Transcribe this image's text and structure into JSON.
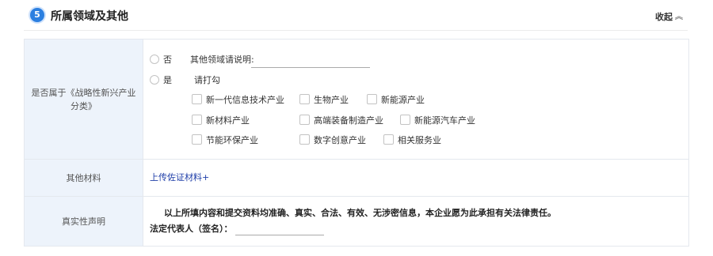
{
  "header": {
    "step_number": "5",
    "title": "所属领域及其他",
    "collapse_label": "收起",
    "collapse_icon": "chevron-up-icon"
  },
  "rows": {
    "strategic": {
      "label": "是否属于《战略性新兴产业分类》",
      "option_no": "否",
      "other_field_label": "其他领域请说明:",
      "other_field_value": "",
      "option_yes": "是",
      "check_prompt": "请打勾",
      "industries": [
        "新一代信息技术产业",
        "生物产业",
        "新能源产业",
        "新材料产业",
        "高端装备制造产业",
        "新能源汽车产业",
        "节能环保产业",
        "数字创意产业",
        "相关服务业"
      ]
    },
    "materials": {
      "label": "其他材料",
      "upload_link": "上传佐证材料+"
    },
    "declaration": {
      "label": "真实性声明",
      "text": "以上所填内容和提交资料均准确、真实、合法、有效、无涉密信息，本企业愿为此承担有关法律责任。",
      "legal_rep_label": "法定代表人（签名）：",
      "legal_rep_value": ""
    }
  },
  "colors": {
    "accent": "#2b7fe0",
    "label_bg": "#edf3fb",
    "link": "#1f3ea8",
    "border": "#e4e8ee"
  }
}
